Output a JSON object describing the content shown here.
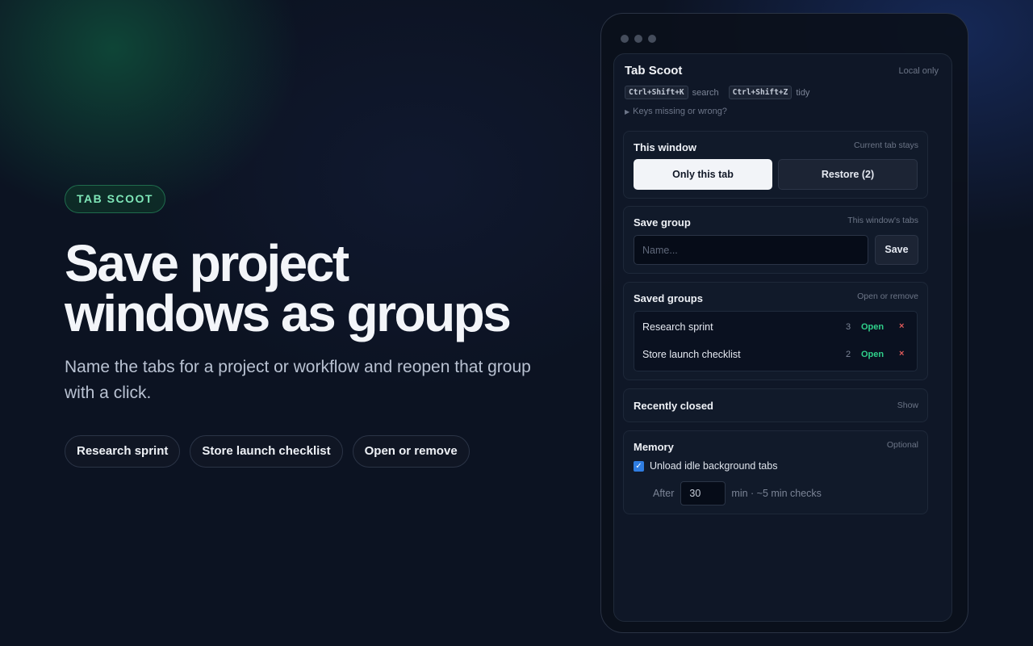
{
  "hero": {
    "badge": "TAB SCOOT",
    "headline_line1": "Save project",
    "headline_line2": "windows as groups",
    "subtitle": "Name the tabs for a project or workflow and reopen that group with a click.",
    "chips": [
      "Research sprint",
      "Store launch checklist",
      "Open or remove"
    ]
  },
  "popup": {
    "title": "Tab Scoot",
    "local_badge": "Local only",
    "shortcuts": [
      {
        "keys": "Ctrl+Shift+K",
        "action": "search"
      },
      {
        "keys": "Ctrl+Shift+Z",
        "action": "tidy"
      }
    ],
    "keys_help": "Keys missing or wrong?",
    "this_window": {
      "title": "This window",
      "hint": "Current tab stays",
      "primary_label": "Only this tab",
      "secondary_label": "Restore (2)"
    },
    "save_group": {
      "title": "Save group",
      "hint": "This window's tabs",
      "placeholder": "Name...",
      "value": "",
      "save_label": "Save"
    },
    "saved_groups": {
      "title": "Saved groups",
      "hint": "Open or remove",
      "items": [
        {
          "name": "Research sprint",
          "count": "3",
          "open_label": "Open",
          "remove_label": "×"
        },
        {
          "name": "Store launch checklist",
          "count": "2",
          "open_label": "Open",
          "remove_label": "×"
        }
      ]
    },
    "recently_closed": {
      "title": "Recently closed",
      "action": "Show"
    },
    "memory": {
      "title": "Memory",
      "hint": "Optional",
      "checkbox_label": "Unload idle background tabs",
      "checked": true,
      "after_label": "After",
      "minutes_value": "30",
      "suffix": "min · ~5 min checks"
    }
  },
  "colors": {
    "background": "#0c1322",
    "accent_green": "#2fd08a",
    "badge_green": "#7fe7b8",
    "remove_red": "#e05a5a",
    "checkbox_blue": "#2f7de1"
  }
}
